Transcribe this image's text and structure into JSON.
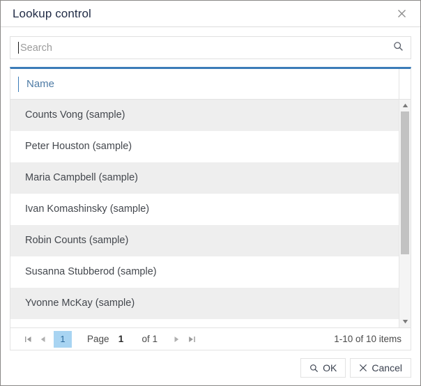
{
  "dialog": {
    "title": "Lookup control",
    "close_label": "×",
    "close_icon": "close-icon",
    "accent_color": "#3b7cb8"
  },
  "search": {
    "placeholder": "Search",
    "value": "",
    "icon": "search-icon"
  },
  "grid": {
    "columns": [
      {
        "label": "Name",
        "key": "name"
      }
    ],
    "rows": [
      {
        "name": "Counts Vong (sample)"
      },
      {
        "name": "Peter Houston (sample)"
      },
      {
        "name": "Maria Campbell (sample)"
      },
      {
        "name": "Ivan Komashinsky (sample)"
      },
      {
        "name": "Robin Counts (sample)"
      },
      {
        "name": "Susanna Stubberod (sample)"
      },
      {
        "name": "Yvonne McKay (sample)"
      }
    ],
    "scrollbar": {
      "up_icon": "triangle-up-icon",
      "down_icon": "triangle-down-icon",
      "thumb_position_percent": 0,
      "thumb_size_percent": 70
    }
  },
  "pager": {
    "first_icon": "first-page-icon",
    "prev_icon": "prev-page-icon",
    "next_icon": "next-page-icon",
    "last_icon": "last-page-icon",
    "current_page_button": "1",
    "page_label": "Page",
    "page_value": "1",
    "of_label": "of 1",
    "info": "1-10 of 10 items",
    "active_page_bg": "#a8d4f2",
    "active_page_fg": "#2c6a9b"
  },
  "footer": {
    "ok_label": "OK",
    "ok_icon": "search-icon",
    "cancel_label": "Cancel",
    "cancel_icon": "close-icon"
  }
}
